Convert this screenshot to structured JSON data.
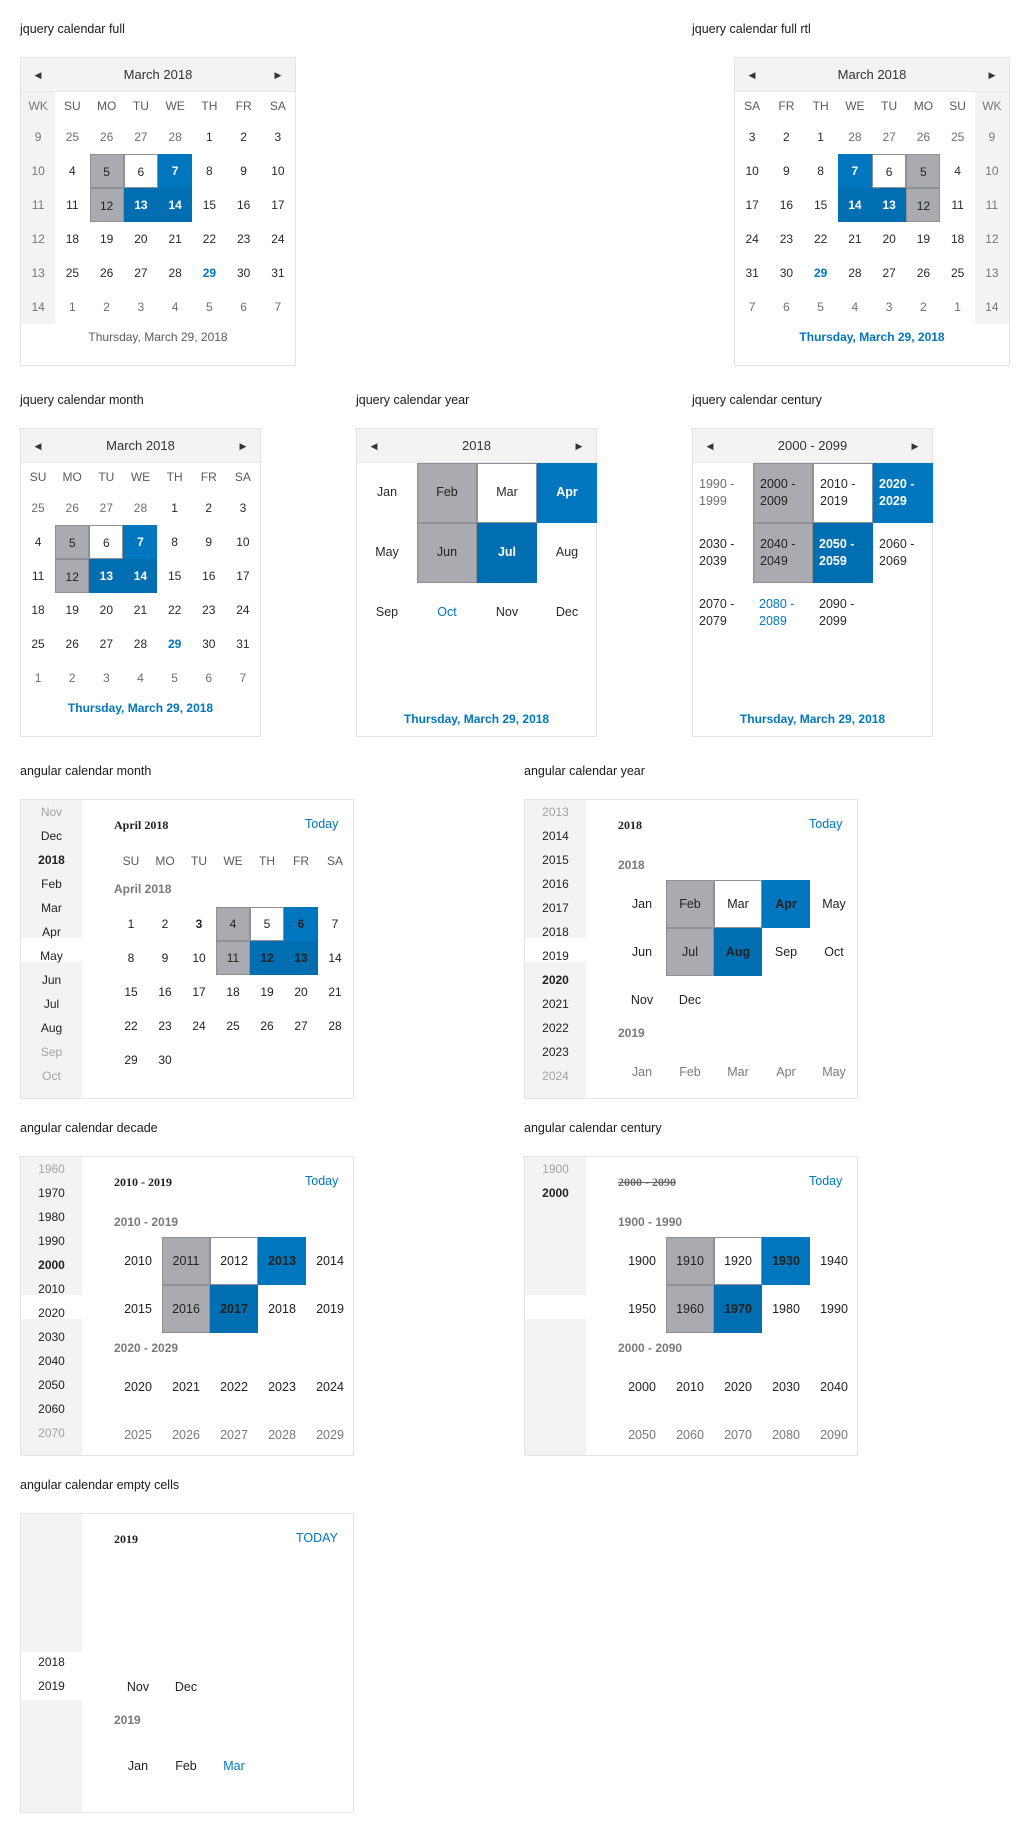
{
  "titles": {
    "full": "jquery calendar full",
    "full_rtl": "jquery calendar full rtl",
    "month": "jquery calendar month",
    "year": "jquery calendar year",
    "century": "jquery calendar century",
    "ang_month": "angular calendar month",
    "ang_year": "angular calendar year",
    "ang_decade": "angular calendar decade",
    "ang_century": "angular calendar century",
    "ang_empty": "angular calendar empty cells"
  },
  "full": {
    "header": "March 2018",
    "prev_icon": "◀",
    "next_icon": "▶",
    "columns": [
      "WK",
      "SU",
      "MO",
      "TU",
      "WE",
      "TH",
      "FR",
      "SA"
    ],
    "columns_rtl": [
      "SA",
      "FR",
      "TH",
      "WE",
      "TU",
      "MO",
      "SU",
      "WK"
    ],
    "weeks": [
      "9",
      "10",
      "11",
      "12",
      "13",
      "14"
    ],
    "rows": [
      [
        "25",
        "26",
        "27",
        "28",
        "1",
        "2",
        "3"
      ],
      [
        "4",
        "5",
        "6",
        "7",
        "8",
        "9",
        "10"
      ],
      [
        "11",
        "12",
        "13",
        "14",
        "15",
        "16",
        "17"
      ],
      [
        "18",
        "19",
        "20",
        "21",
        "22",
        "23",
        "24"
      ],
      [
        "25",
        "26",
        "27",
        "28",
        "29",
        "30",
        "31"
      ],
      [
        "1",
        "2",
        "3",
        "4",
        "5",
        "6",
        "7"
      ]
    ],
    "footer": "Thursday, March 29, 2018"
  },
  "year": {
    "header": "2018",
    "months": [
      "Jan",
      "Feb",
      "Mar",
      "Apr",
      "May",
      "Jun",
      "Jul",
      "Aug",
      "Sep",
      "Oct",
      "Nov",
      "Dec"
    ],
    "footer": "Thursday, March 29, 2018"
  },
  "century": {
    "header": "2000 - 2099",
    "decades": [
      "1990 - 1999",
      "2000 - 2009",
      "2010 - 2019",
      "2020 - 2029",
      "2030 - 2039",
      "2040 - 2049",
      "2050 - 2059",
      "2060 - 2069",
      "2070 - 2079",
      "2080 - 2089",
      "2090 - 2099"
    ],
    "footer": "Thursday, March 29, 2018"
  },
  "ang_month": {
    "nav": [
      "Nov",
      "Dec",
      "2018",
      "Feb",
      "Mar",
      "Apr",
      "May",
      "Jun",
      "Jul",
      "Aug",
      "Sep",
      "Oct"
    ],
    "header": "April 2018",
    "today": "Today",
    "days_of_week": [
      "SU",
      "MO",
      "TU",
      "WE",
      "TH",
      "FR",
      "SA"
    ],
    "sub": "April 2018",
    "rows": [
      [
        "1",
        "2",
        "3",
        "4",
        "5",
        "6",
        "7"
      ],
      [
        "8",
        "9",
        "10",
        "11",
        "12",
        "13",
        "14"
      ],
      [
        "15",
        "16",
        "17",
        "18",
        "19",
        "20",
        "21"
      ],
      [
        "22",
        "23",
        "24",
        "25",
        "26",
        "27",
        "28"
      ],
      [
        "29",
        "30"
      ]
    ]
  },
  "ang_year": {
    "nav": [
      "2013",
      "2014",
      "2015",
      "2016",
      "2017",
      "2018",
      "2019",
      "2020",
      "2021",
      "2022",
      "2023",
      "2024"
    ],
    "header": "2018",
    "today": "Today",
    "sub1": "2018",
    "rows1": [
      [
        "Jan",
        "Feb",
        "Mar",
        "Apr",
        "May"
      ],
      [
        "Jun",
        "Jul",
        "Aug",
        "Sep",
        "Oct"
      ],
      [
        "Nov",
        "Dec"
      ]
    ],
    "sub2": "2019",
    "rows2": [
      [
        "Jan",
        "Feb",
        "Mar",
        "Apr",
        "May"
      ]
    ]
  },
  "ang_decade": {
    "nav": [
      "1960",
      "1970",
      "1980",
      "1990",
      "2000",
      "2010",
      "2020",
      "2030",
      "2040",
      "2050",
      "2060",
      "2070"
    ],
    "header": "2010 - 2019",
    "today": "Today",
    "sub1": "2010 - 2019",
    "rows1": [
      [
        "2010",
        "2011",
        "2012",
        "2013",
        "2014"
      ],
      [
        "2015",
        "2016",
        "2017",
        "2018",
        "2019"
      ]
    ],
    "sub2": "2020 - 2029",
    "rows2": [
      [
        "2020",
        "2021",
        "2022",
        "2023",
        "2024"
      ],
      [
        "2025",
        "2026",
        "2027",
        "2028",
        "2029"
      ]
    ]
  },
  "ang_century": {
    "nav": [
      "1900",
      "2000"
    ],
    "header": "2000 - 2090",
    "today": "Today",
    "sub1": "1900 - 1990",
    "rows1": [
      [
        "1900",
        "1910",
        "1920",
        "1930",
        "1940"
      ],
      [
        "1950",
        "1960",
        "1970",
        "1980",
        "1990"
      ]
    ],
    "sub2": "2000 - 2090",
    "rows2": [
      [
        "2000",
        "2010",
        "2020",
        "2030",
        "2040"
      ],
      [
        "2050",
        "2060",
        "2070",
        "2080",
        "2090"
      ]
    ]
  },
  "ang_empty": {
    "nav": [
      "2018",
      "2019"
    ],
    "header": "2019",
    "today": "TODAY",
    "row1": [
      "Nov",
      "Dec"
    ],
    "sub": "2019",
    "row2": [
      "Jan",
      "Feb",
      "Mar"
    ]
  },
  "colors": {
    "accent": "#0076be",
    "selected": "#a9abb0",
    "nav_bg": "#f3f3f3"
  }
}
